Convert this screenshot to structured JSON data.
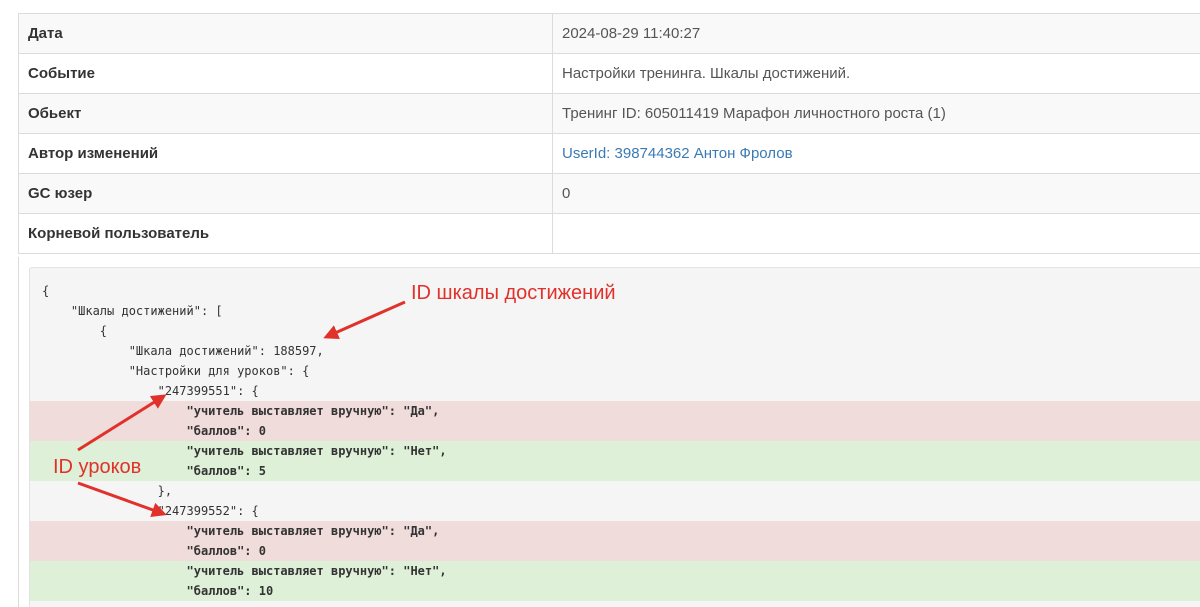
{
  "details": {
    "rows": [
      {
        "label": "Дата",
        "value": "2024-08-29 11:40:27"
      },
      {
        "label": "Событие",
        "value": "Настройки тренинга. Шкалы достижений."
      },
      {
        "label": "Обьект",
        "value": "Тренинг ID: 605011419 Марафон личностного роста (1)"
      },
      {
        "label": "Автор изменений",
        "value": "UserId: 398744362 Антон Фролов"
      },
      {
        "label": "GC юзер",
        "value": "0"
      },
      {
        "label": "Корневой пользователь",
        "value": ""
      }
    ]
  },
  "code": {
    "lines": [
      {
        "text": "{",
        "type": "normal"
      },
      {
        "text": "    \"Шкалы достижений\": [",
        "type": "normal"
      },
      {
        "text": "        {",
        "type": "normal"
      },
      {
        "text": "            \"Шкала достижений\": 188597,",
        "type": "normal"
      },
      {
        "text": "            \"Настройки для уроков\": {",
        "type": "normal"
      },
      {
        "text": "                \"247399551\": {",
        "type": "normal"
      },
      {
        "text": "                    \"учитель выставляет вручную\": \"Да\",",
        "type": "del"
      },
      {
        "text": "                    \"баллов\": 0",
        "type": "del"
      },
      {
        "text": "                    \"учитель выставляет вручную\": \"Нет\",",
        "type": "add"
      },
      {
        "text": "                    \"баллов\": 5",
        "type": "add"
      },
      {
        "text": "                },",
        "type": "normal"
      },
      {
        "text": "                \"247399552\": {",
        "type": "normal"
      },
      {
        "text": "                    \"учитель выставляет вручную\": \"Да\",",
        "type": "del"
      },
      {
        "text": "                    \"баллов\": 0",
        "type": "del"
      },
      {
        "text": "                    \"учитель выставляет вручную\": \"Нет\",",
        "type": "add"
      },
      {
        "text": "                    \"баллов\": 10",
        "type": "add"
      }
    ]
  },
  "annotations": {
    "scale_id": "ID шкалы достижений",
    "lesson_ids": "ID уроков"
  },
  "colors": {
    "annotation": "#e0312b",
    "removed_bg": "#f1dcdc",
    "added_bg": "#dff0d8",
    "link": "#3b7ab5"
  }
}
